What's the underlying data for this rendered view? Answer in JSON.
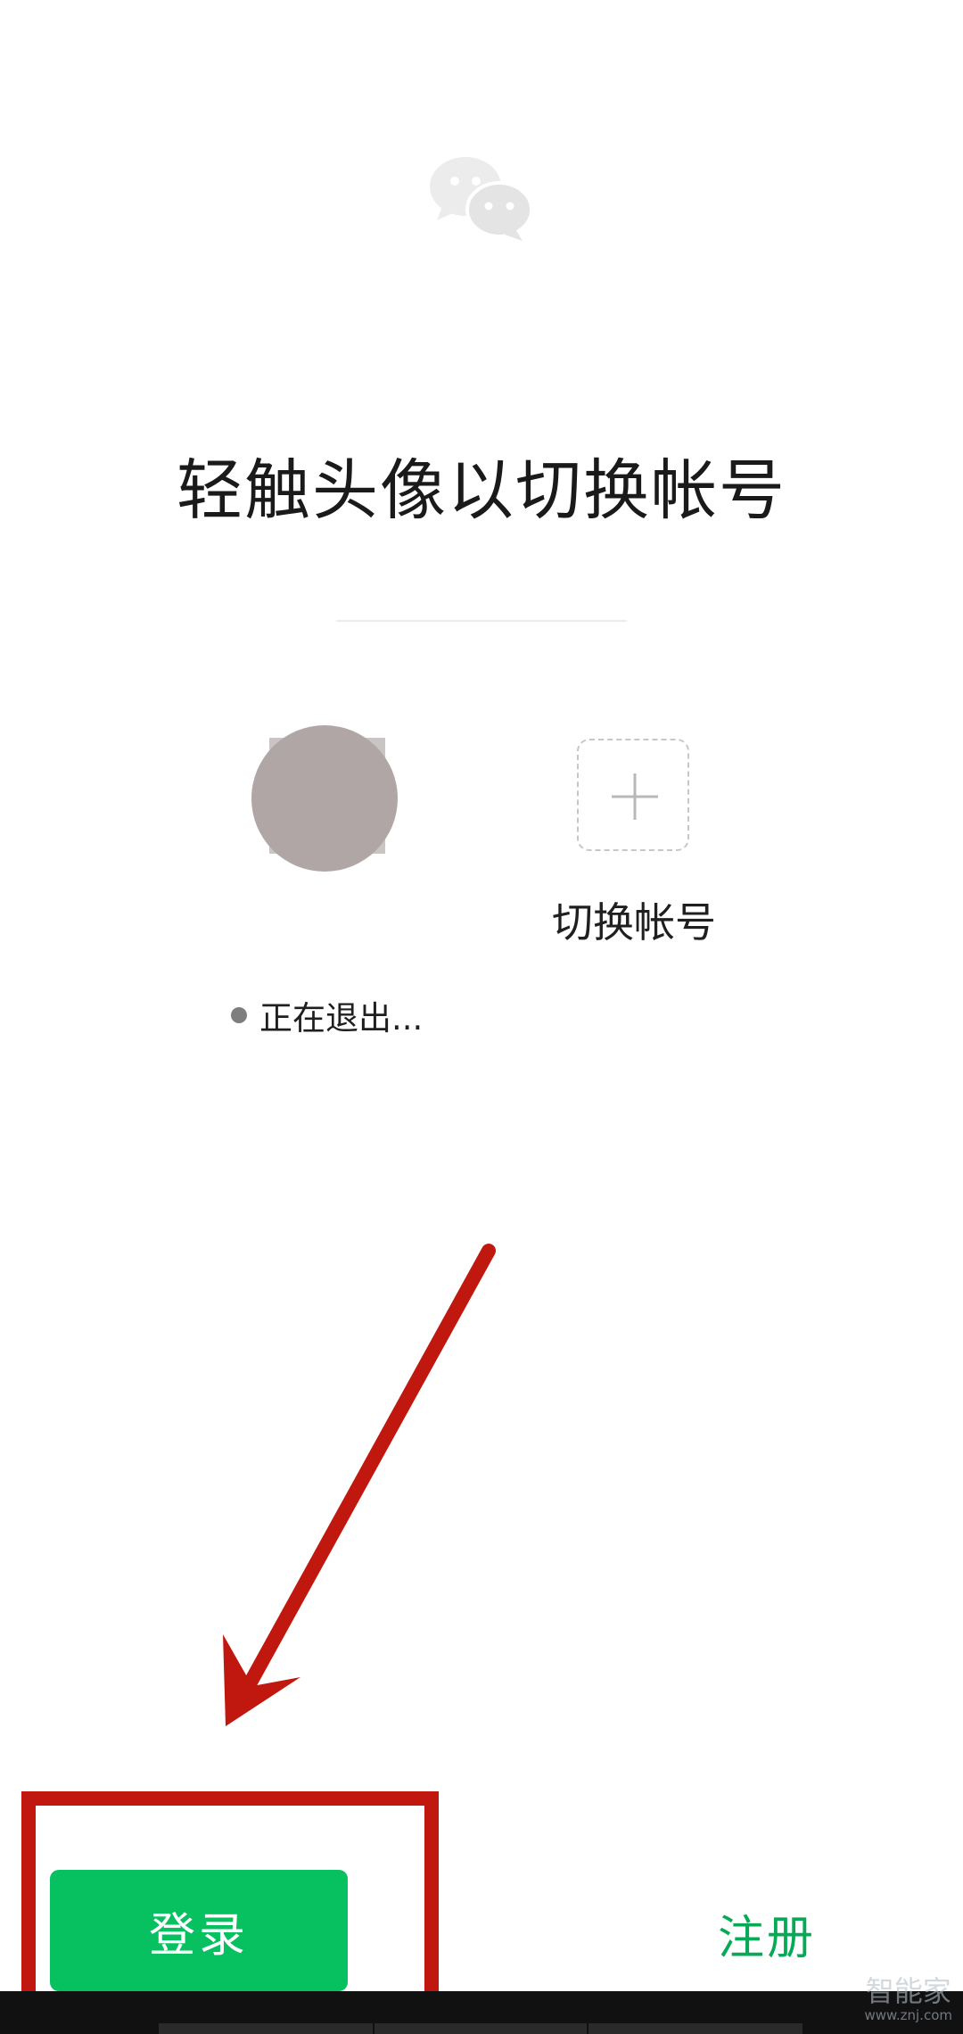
{
  "screen": {
    "title": "轻触头像以切换帐号",
    "switch_account_label": "切换帐号",
    "status_text": "正在退出...",
    "login_button": "登录",
    "register_link": "注册"
  },
  "icons": {
    "app_logo": "wechat-logo-icon",
    "add_account": "plus-icon",
    "annotation_arrow": "arrow-icon"
  },
  "colors": {
    "primary_green": "#07c160",
    "register_green": "#07a956",
    "annotation_red": "#c0180f",
    "avatar_gray": "#b1a6a6"
  },
  "watermark": {
    "main": "智能家",
    "sub": "www.znj.com"
  }
}
